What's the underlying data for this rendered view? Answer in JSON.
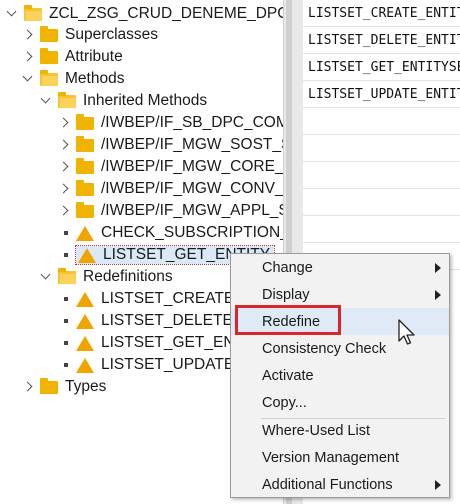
{
  "tree": {
    "root": "ZCL_ZSG_CRUD_DENEME_DPC_EXT",
    "superclasses": "Superclasses",
    "attribute": "Attribute",
    "methods": "Methods",
    "inherited_methods": "Inherited Methods",
    "interfaces": [
      "/IWBEP/IF_SB_DPC_COMM_SERVICES",
      "/IWBEP/IF_MGW_SOST_SRV_RUNTIME",
      "/IWBEP/IF_MGW_CORE_SRV_RUNTIME",
      "/IWBEP/IF_MGW_CONV_SRV_RUNTIME",
      "/IWBEP/IF_MGW_APPL_SRV_RUNTIME"
    ],
    "method_items": [
      "CHECK_SUBSCRIPTION_AUTHORITY",
      "LISTSET_GET_ENTITY"
    ],
    "redefinitions": "Redefinitions",
    "redefinition_items": [
      "LISTSET_CREATE_ENTITY",
      "LISTSET_DELETE_ENTITY",
      "LISTSET_GET_ENTITY",
      "LISTSET_UPDATE_ENTITY"
    ],
    "types": "Types"
  },
  "right_list": [
    "LISTSET_CREATE_ENTITY",
    "LISTSET_DELETE_ENTITY",
    "LISTSET_GET_ENTITYSET",
    "LISTSET_UPDATE_ENTITY"
  ],
  "context_menu": {
    "change": "Change",
    "display": "Display",
    "redefine": "Redefine",
    "consistency_check": "Consistency Check",
    "activate": "Activate",
    "copy": "Copy...",
    "where_used": "Where-Used List",
    "version_management": "Version Management",
    "additional_functions": "Additional Functions"
  },
  "colors": {
    "highlight_border": "#d9262b",
    "folder": "#f0b400",
    "warning_triangle": "#f0a400",
    "menu_hover": "#dfeaf6"
  }
}
